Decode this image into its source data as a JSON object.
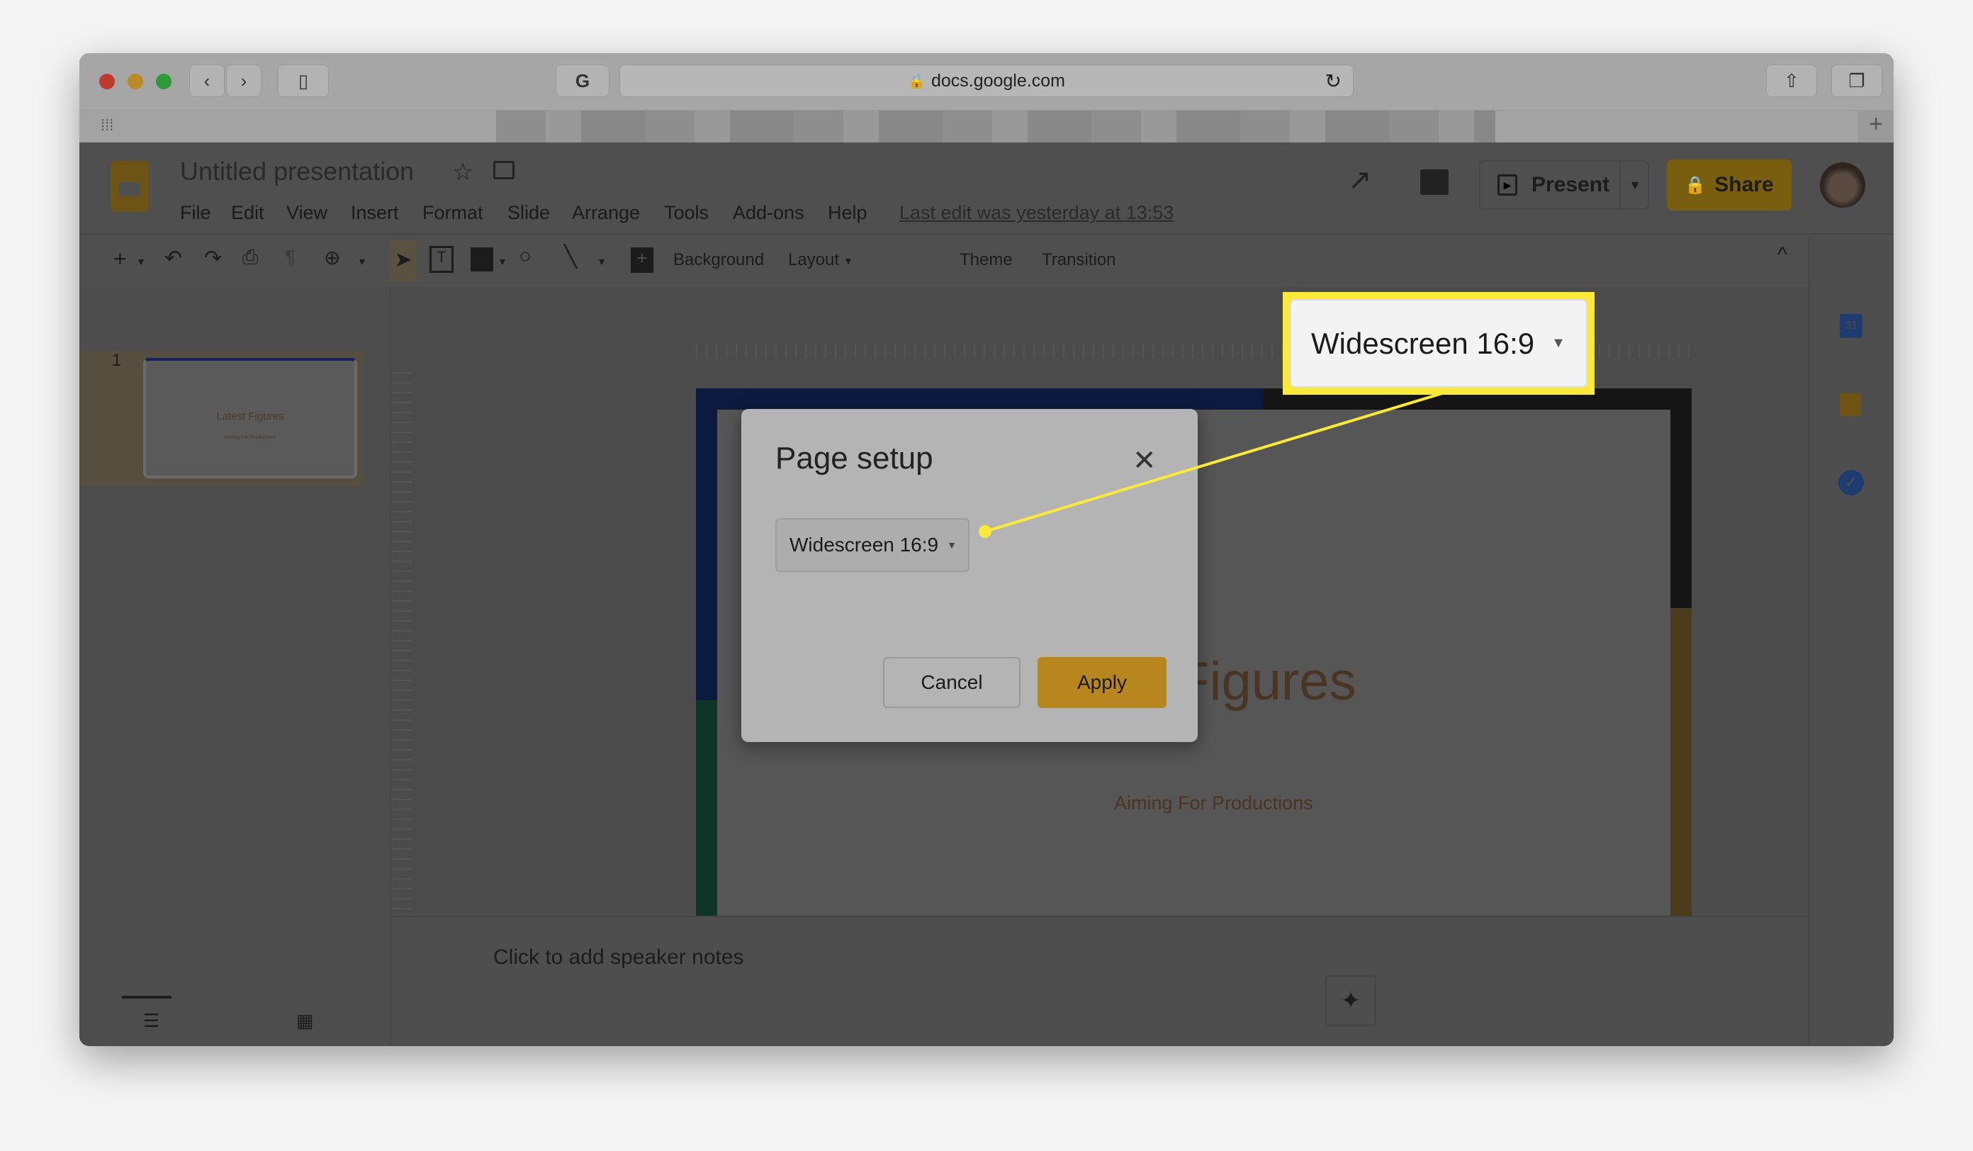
{
  "browser": {
    "url": "docs.google.com"
  },
  "app": {
    "title": "Untitled presentation",
    "menu": [
      "File",
      "Edit",
      "View",
      "Insert",
      "Format",
      "Slide",
      "Arrange",
      "Tools",
      "Add-ons",
      "Help"
    ],
    "last_edit": "Last edit was yesterday at 13:53",
    "present_label": "Present",
    "share_label": "Share",
    "brand_color": "#f4b400"
  },
  "toolbar": {
    "background": "Background",
    "layout": "Layout",
    "theme": "Theme",
    "transition": "Transition"
  },
  "filmstrip": {
    "slide_number": "1",
    "thumb_title": "Latest Figures",
    "thumb_subtitle": "Aiming For Productions"
  },
  "slide": {
    "title": "Latest Figures",
    "subtitle": "Aiming For Productions"
  },
  "notes": {
    "placeholder": "Click to add speaker notes"
  },
  "side_panel": {
    "calendar_day": "31"
  },
  "dialog": {
    "title": "Page setup",
    "selected": "Widescreen 16:9",
    "cancel": "Cancel",
    "apply": "Apply"
  },
  "callout": {
    "label": "Widescreen 16:9",
    "color": "#fde93a"
  }
}
